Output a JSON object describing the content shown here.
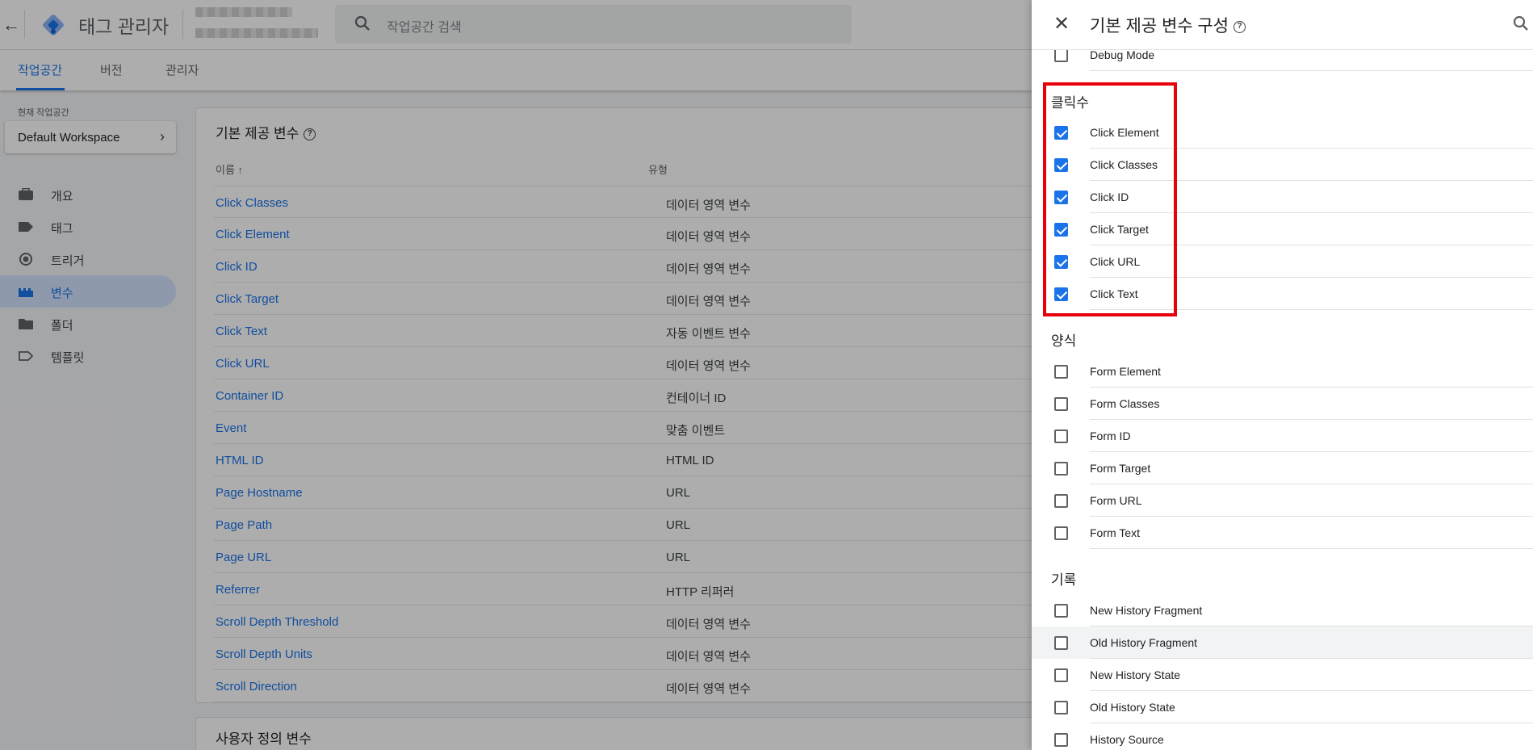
{
  "header": {
    "back_icon": "arrow-back-icon",
    "app_title": "태그 관리자",
    "search_placeholder": "작업공간 검색"
  },
  "tabs": [
    {
      "label": "작업공간",
      "active": true
    },
    {
      "label": "버전",
      "active": false
    },
    {
      "label": "관리자",
      "active": false
    }
  ],
  "workspace": {
    "caption": "현재 작업공간",
    "name": "Default Workspace"
  },
  "nav": [
    {
      "label": "개요",
      "icon": "briefcase-icon",
      "active": false
    },
    {
      "label": "태그",
      "icon": "tag-icon",
      "active": false
    },
    {
      "label": "트리거",
      "icon": "trigger-icon",
      "active": false
    },
    {
      "label": "변수",
      "icon": "variables-icon",
      "active": true
    },
    {
      "label": "폴더",
      "icon": "folder-icon",
      "active": false
    },
    {
      "label": "템플릿",
      "icon": "template-icon",
      "active": false
    }
  ],
  "builtin_table": {
    "title": "기본 제공 변수",
    "col_name": "이름 ↑",
    "col_type": "유형",
    "rows": [
      {
        "name": "Click Classes",
        "type": "데이터 영역 변수"
      },
      {
        "name": "Click Element",
        "type": "데이터 영역 변수"
      },
      {
        "name": "Click ID",
        "type": "데이터 영역 변수"
      },
      {
        "name": "Click Target",
        "type": "데이터 영역 변수"
      },
      {
        "name": "Click Text",
        "type": "자동 이벤트 변수"
      },
      {
        "name": "Click URL",
        "type": "데이터 영역 변수"
      },
      {
        "name": "Container ID",
        "type": "컨테이너 ID"
      },
      {
        "name": "Event",
        "type": "맞춤 이벤트"
      },
      {
        "name": "HTML ID",
        "type": "HTML ID"
      },
      {
        "name": "Page Hostname",
        "type": "URL"
      },
      {
        "name": "Page Path",
        "type": "URL"
      },
      {
        "name": "Page URL",
        "type": "URL"
      },
      {
        "name": "Referrer",
        "type": "HTTP 리퍼러"
      },
      {
        "name": "Scroll Depth Threshold",
        "type": "데이터 영역 변수"
      },
      {
        "name": "Scroll Depth Units",
        "type": "데이터 영역 변수"
      },
      {
        "name": "Scroll Direction",
        "type": "데이터 영역 변수"
      }
    ]
  },
  "user_table": {
    "title": "사용자 정의 변수"
  },
  "drawer": {
    "title": "기본 제공 변수 구성",
    "debug": {
      "label": "Debug Mode",
      "checked": false
    },
    "sections": [
      {
        "title": "클릭수",
        "items": [
          {
            "label": "Click Element",
            "checked": true
          },
          {
            "label": "Click Classes",
            "checked": true
          },
          {
            "label": "Click ID",
            "checked": true
          },
          {
            "label": "Click Target",
            "checked": true
          },
          {
            "label": "Click URL",
            "checked": true
          },
          {
            "label": "Click Text",
            "checked": true
          }
        ]
      },
      {
        "title": "양식",
        "items": [
          {
            "label": "Form Element",
            "checked": false
          },
          {
            "label": "Form Classes",
            "checked": false
          },
          {
            "label": "Form ID",
            "checked": false
          },
          {
            "label": "Form Target",
            "checked": false
          },
          {
            "label": "Form URL",
            "checked": false
          },
          {
            "label": "Form Text",
            "checked": false
          }
        ]
      },
      {
        "title": "기록",
        "items": [
          {
            "label": "New History Fragment",
            "checked": false
          },
          {
            "label": "Old History Fragment",
            "checked": false
          },
          {
            "label": "New History State",
            "checked": false
          },
          {
            "label": "Old History State",
            "checked": false
          },
          {
            "label": "History Source",
            "checked": false
          }
        ]
      }
    ]
  },
  "colors": {
    "accent": "#1a73e8",
    "highlight_box": "#e8000b",
    "nav_active_bg": "#d2e3fc"
  }
}
